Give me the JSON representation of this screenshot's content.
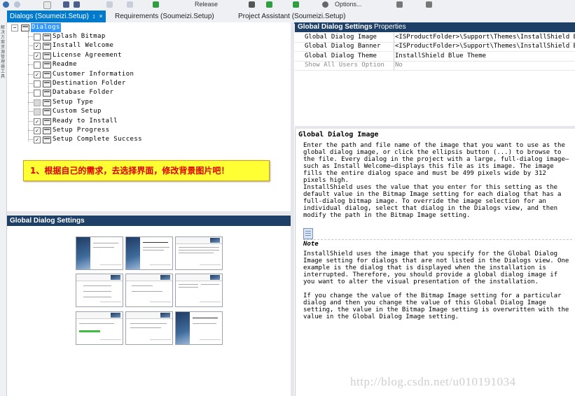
{
  "toolbar": {
    "config_label": "Release",
    "options_label": "Options..."
  },
  "tabs": [
    {
      "label": "Dialogs (Soumeizi.Setup)",
      "pin": "↕",
      "close": "×"
    },
    {
      "label": "Requirements (Soumeizi.Setup)"
    },
    {
      "label": "Project Assistant (Soumeizi.Setup)"
    }
  ],
  "left_strip": {
    "label": "解决方案资源管理器 工具"
  },
  "tree": {
    "root": {
      "label": "Dialogs",
      "expander": "−"
    },
    "items": [
      {
        "label": "Splash Bitmap",
        "checked": false,
        "mark": ""
      },
      {
        "label": "Install Welcome",
        "checked": true,
        "mark": "✓"
      },
      {
        "label": "License Agreement",
        "checked": true,
        "mark": "✓"
      },
      {
        "label": "Readme",
        "checked": false,
        "mark": ""
      },
      {
        "label": "Customer Information",
        "checked": true,
        "mark": "✓"
      },
      {
        "label": "Destination Folder",
        "checked": false,
        "mark": ""
      },
      {
        "label": "Database Folder",
        "checked": false,
        "mark": ""
      },
      {
        "label": "Setup Type",
        "checked": false,
        "mark": "",
        "disabled": true
      },
      {
        "label": "Custom Setup",
        "checked": false,
        "mark": "",
        "disabled": true
      },
      {
        "label": "Ready to Install",
        "checked": true,
        "mark": "✓"
      },
      {
        "label": "Setup Progress",
        "checked": true,
        "mark": "✓"
      },
      {
        "label": "Setup Complete Success",
        "checked": true,
        "mark": "✓"
      }
    ]
  },
  "annotation": {
    "text": "1、根据自己的需求，去选择界面，修改背景图片吧！"
  },
  "preview": {
    "header": "Global Dialog Settings"
  },
  "properties": {
    "tab_active": "Global Dialog Settings",
    "tab_other": "Properties",
    "rows": [
      {
        "name": "Global Dialog Image",
        "value": "<ISProductFolder>\\Support\\Themes\\InstallShield Bl...",
        "disabled": false
      },
      {
        "name": "Global Dialog Banner",
        "value": "<ISProductFolder>\\Support\\Themes\\InstallShield Blue",
        "disabled": false
      },
      {
        "name": "Global Dialog Theme",
        "value": "InstallShield Blue Theme",
        "disabled": false
      },
      {
        "name": "Show All Users Option",
        "value": "No",
        "disabled": true
      }
    ]
  },
  "help": {
    "title": "Global Dialog Image",
    "p1": "Enter the path and file name of the image that you want to use as the global dialog image, or click the ellipsis button (...) to browse to the file. Every dialog in the project with a large, full-dialog image—such as Install Welcome—displays this file as its image. The image fills the entire dialog space and must be 499 pixels wide by 312 pixels high.",
    "p2": "InstallShield uses the value that you enter for this setting as the default value in the Bitmap Image setting for each dialog that has a full-dialog bitmap image. To override the image selection for an individual dialog, select that dialog in the Dialogs view, and then modify the path in the Bitmap Image setting.",
    "note_label": "Note",
    "p3": "InstallShield uses the image that you specify for the Global Dialog Image setting for dialogs that are not listed in the Dialogs view. One example is the dialog that is displayed when the installation is interrupted. Therefore, you should provide a global dialog image if you want to alter the visual presentation of the installation.",
    "p4": "If you change the value of the Bitmap Image setting for a particular dialog and then you change the value of this Global Dialog Image setting, the value in the Bitmap Image setting is overwritten with the value in the Global Dialog Image setting."
  },
  "watermark": "http://blog.csdn.net/u010191034"
}
